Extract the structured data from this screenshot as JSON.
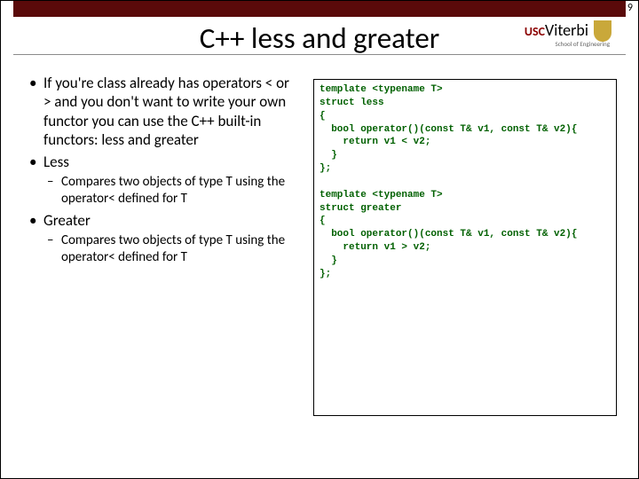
{
  "page_number": "9",
  "logo": {
    "usc": "USC",
    "viterbi": "Viterbi",
    "sub": "School of Engineering"
  },
  "title": "C++ less and greater",
  "bullets": {
    "b1": "If you're class already has operators < or > and you don't want to write your own functor you can use the C++ built-in functors: less and greater",
    "b2": "Less",
    "b2_1": "Compares two objects of type T using the operator< defined for T",
    "b3": "Greater",
    "b3_1": "Compares two objects of type T using the operator< defined for T"
  },
  "code": "template <typename T>\nstruct less\n{\n  bool operator()(const T& v1, const T& v2){\n    return v1 < v2;\n  }\n};\n\ntemplate <typename T>\nstruct greater\n{\n  bool operator()(const T& v1, const T& v2){\n    return v1 > v2;\n  }\n};"
}
